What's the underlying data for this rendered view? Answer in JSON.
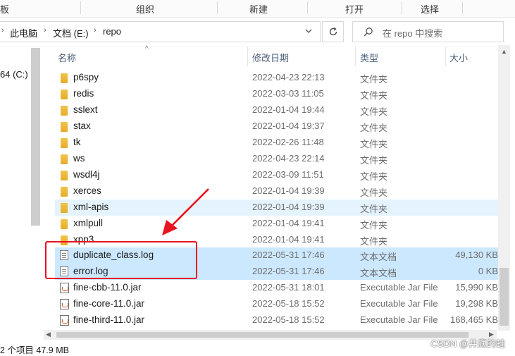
{
  "ribbon": {
    "groups": [
      "板",
      "组织",
      "新建",
      "打开",
      "选择"
    ]
  },
  "address": {
    "crumbs": [
      "此电脑",
      "文档 (E:)",
      "repo"
    ]
  },
  "search": {
    "placeholder": "在 repo 中搜索"
  },
  "nav": {
    "drive_label": "64 (C:)"
  },
  "columns": {
    "name": "名称",
    "date": "修改日期",
    "type": "类型",
    "size": "大小"
  },
  "files": [
    {
      "name": "p6spy",
      "date": "2022-04-23 22:13",
      "type": "文件夹",
      "size": "",
      "kind": "folder"
    },
    {
      "name": "redis",
      "date": "2022-03-03 11:05",
      "type": "文件夹",
      "size": "",
      "kind": "folder"
    },
    {
      "name": "sslext",
      "date": "2022-01-04 19:44",
      "type": "文件夹",
      "size": "",
      "kind": "folder"
    },
    {
      "name": "stax",
      "date": "2022-01-04 19:37",
      "type": "文件夹",
      "size": "",
      "kind": "folder"
    },
    {
      "name": "tk",
      "date": "2022-02-26 11:48",
      "type": "文件夹",
      "size": "",
      "kind": "folder"
    },
    {
      "name": "ws",
      "date": "2022-04-23 22:14",
      "type": "文件夹",
      "size": "",
      "kind": "folder"
    },
    {
      "name": "wsdl4j",
      "date": "2022-03-09 11:51",
      "type": "文件夹",
      "size": "",
      "kind": "folder"
    },
    {
      "name": "xerces",
      "date": "2022-01-04 19:39",
      "type": "文件夹",
      "size": "",
      "kind": "folder"
    },
    {
      "name": "xml-apis",
      "date": "2022-01-04 19:39",
      "type": "文件夹",
      "size": "",
      "kind": "folder",
      "state": "hover"
    },
    {
      "name": "xmlpull",
      "date": "2022-01-04 19:41",
      "type": "文件夹",
      "size": "",
      "kind": "folder"
    },
    {
      "name": "xpp3",
      "date": "2022-01-04 19:41",
      "type": "文件夹",
      "size": "",
      "kind": "folder"
    },
    {
      "name": "duplicate_class.log",
      "date": "2022-05-31 17:46",
      "type": "文本文档",
      "size": "49,130 KB",
      "kind": "doc",
      "state": "selected"
    },
    {
      "name": "error.log",
      "date": "2022-05-31 17:46",
      "type": "文本文档",
      "size": "0 KB",
      "kind": "doc",
      "state": "selected"
    },
    {
      "name": "fine-cbb-11.0.jar",
      "date": "2022-05-31 18:01",
      "type": "Executable Jar File",
      "size": "15,990 KB",
      "kind": "jar"
    },
    {
      "name": "fine-core-11.0.jar",
      "date": "2022-05-18 15:52",
      "type": "Executable Jar File",
      "size": "19,298 KB",
      "kind": "jar"
    },
    {
      "name": "fine-third-11.0.jar",
      "date": "2022-05-18 15:52",
      "type": "Executable Jar File",
      "size": "168,465 KB",
      "kind": "jar"
    }
  ],
  "status": {
    "text": "2 个项目  47.9 MB"
  },
  "watermark": "CSDN @井底的蛙",
  "colors": {
    "selected": "#cce8ff",
    "hover": "#e5f3ff",
    "annotation": "#e8141f"
  }
}
